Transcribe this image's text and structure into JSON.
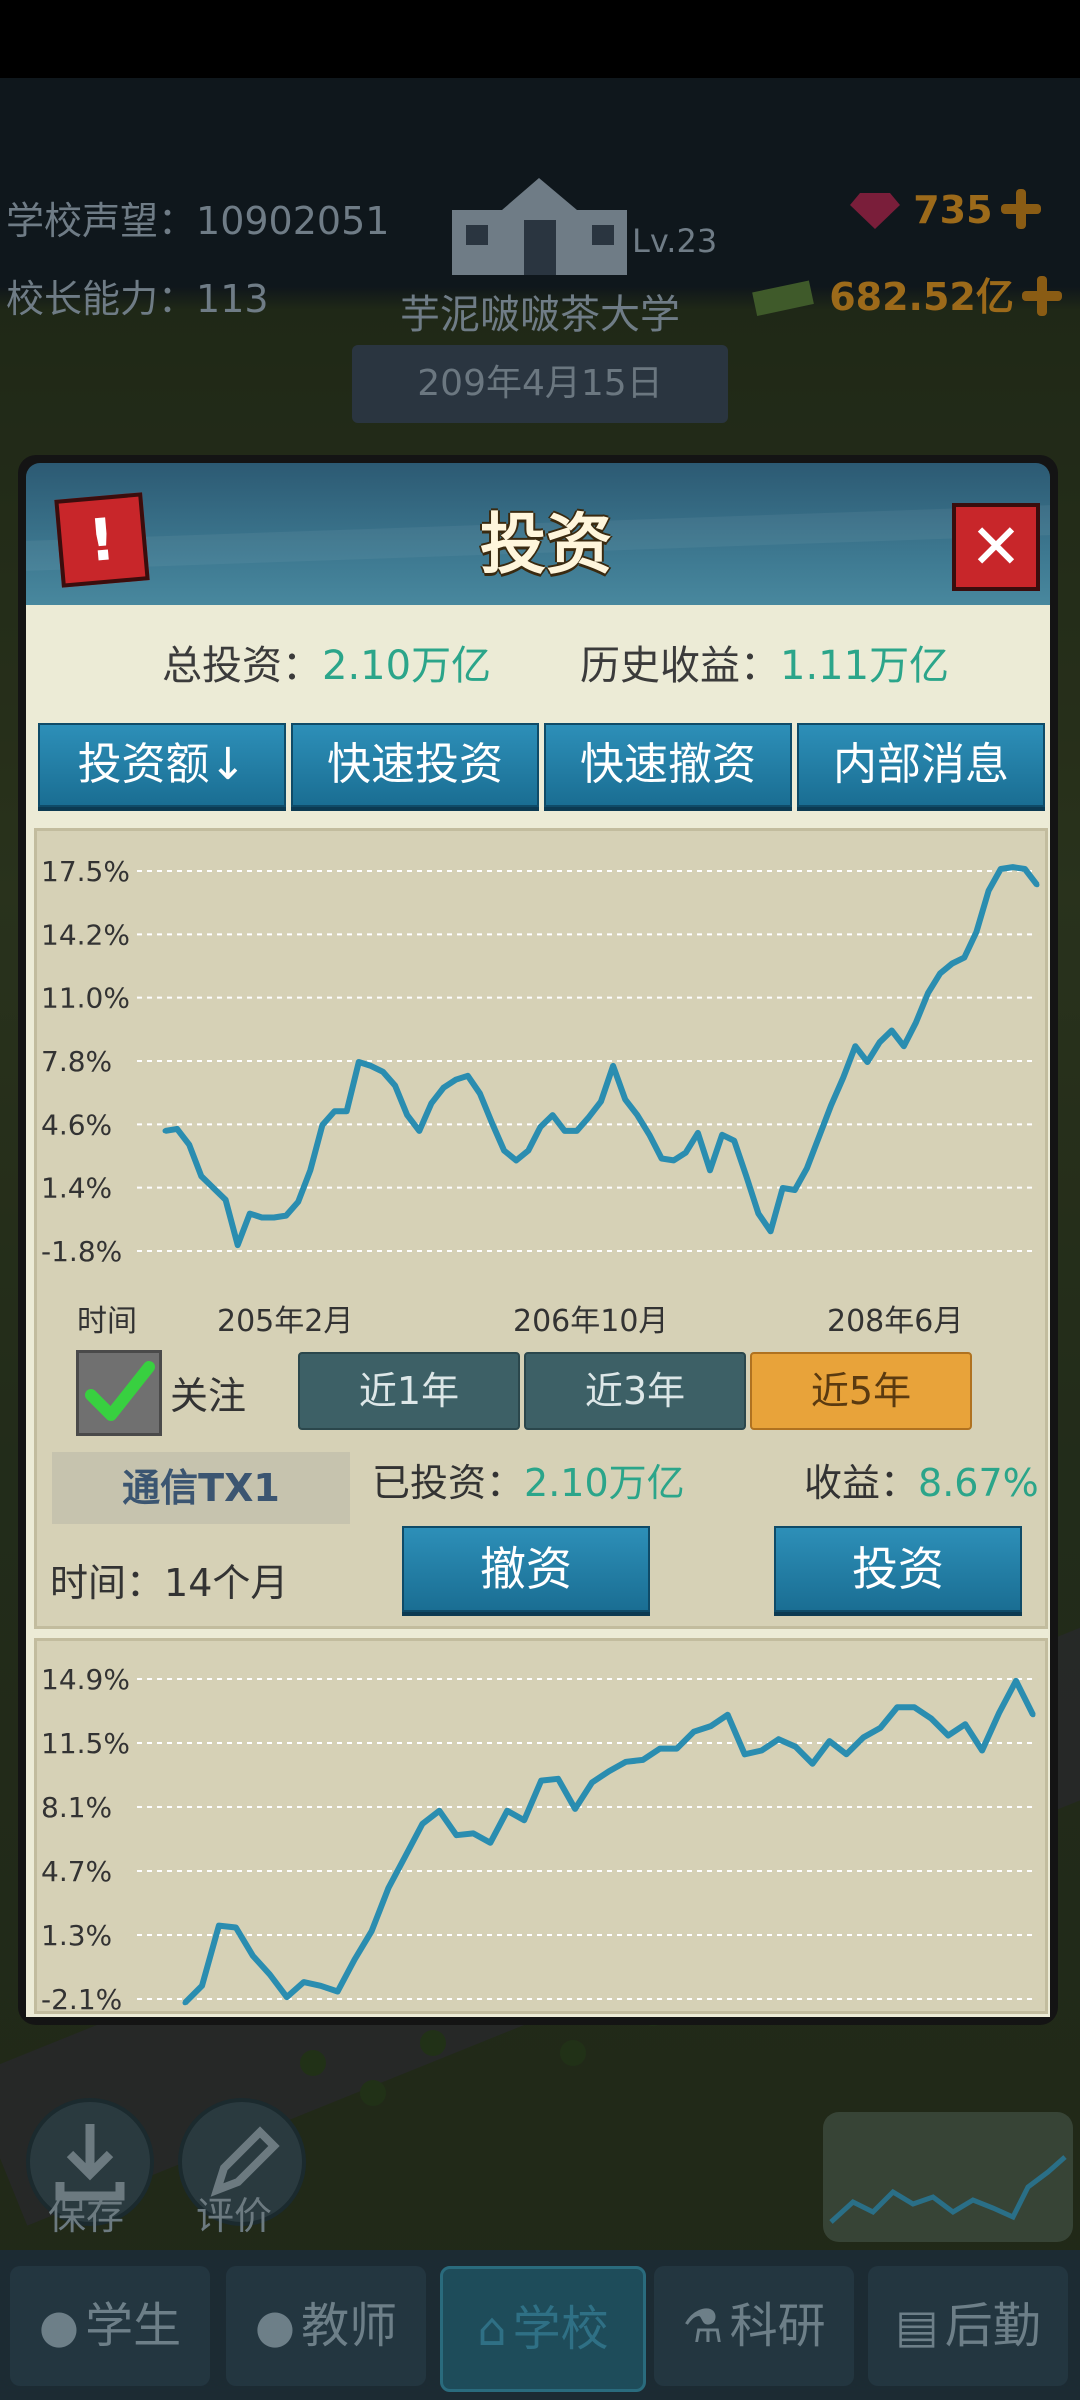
{
  "header": {
    "reputation_label": "学校声望：",
    "reputation_value": "10902051",
    "ability_label": "校长能力：",
    "ability_value": "113",
    "school_name": "芋泥啵啵茶大学",
    "level": "Lv.23",
    "date": "209年4月15日",
    "gems": "735",
    "money": "682.52亿"
  },
  "modal": {
    "title": "投资",
    "total_label": "总投资：",
    "total_value": "2.10万亿",
    "history_label": "历史收益：",
    "history_value": "1.11万亿",
    "tabs": [
      "投资额↓",
      "快速投资",
      "快速撤资",
      "内部消息"
    ],
    "follow_label": "关注",
    "follow_checked": true,
    "periods": [
      "近1年",
      "近3年",
      "近5年"
    ],
    "active_period": "近5年",
    "stock": {
      "name": "通信TX1",
      "invested_label": "已投资：",
      "invested_value": "2.10万亿",
      "return_label": "收益：",
      "return_value": "8.67%",
      "time_label": "时间：",
      "time_value": "14个月"
    },
    "actions": [
      "撤资",
      "投资"
    ]
  },
  "chart_data": [
    {
      "type": "line",
      "ytick_labels": [
        "17.5%",
        "14.2%",
        "11.0%",
        "7.8%",
        "4.6%",
        "1.4%",
        "-1.8%"
      ],
      "ylim": [
        -1.8,
        17.5
      ],
      "xlabel": "时间",
      "xtick_labels": [
        "205年2月",
        "206年10月",
        "208年6月"
      ],
      "grid": true,
      "color": "#2a8db0",
      "values": [
        4.3,
        4.4,
        3.6,
        2.0,
        1.4,
        0.8,
        -1.5,
        0.1,
        -0.1,
        -0.1,
        0.0,
        0.7,
        2.3,
        4.6,
        5.3,
        5.3,
        7.8,
        7.6,
        7.3,
        6.6,
        5.1,
        4.3,
        5.7,
        6.5,
        6.9,
        7.1,
        6.2,
        4.7,
        3.3,
        2.8,
        3.3,
        4.5,
        5.1,
        4.3,
        4.3,
        5.0,
        5.8,
        7.6,
        5.9,
        5.1,
        4.1,
        2.9,
        2.8,
        3.2,
        4.2,
        2.3,
        4.1,
        3.8,
        2.0,
        0.1,
        -0.8,
        1.4,
        1.3,
        2.4,
        4.0,
        5.6,
        7.0,
        8.6,
        7.8,
        8.8,
        9.4,
        8.6,
        9.8,
        11.3,
        12.3,
        12.8,
        13.1,
        14.4,
        16.5,
        17.6,
        17.7,
        17.6,
        16.8
      ]
    },
    {
      "type": "line",
      "ytick_labels": [
        "14.9%",
        "11.5%",
        "8.1%",
        "4.7%",
        "1.3%",
        "-2.1%"
      ],
      "ylim": [
        -2.1,
        14.9
      ],
      "grid": true,
      "color": "#2a8db0",
      "values": [
        -2.3,
        -1.4,
        1.8,
        1.7,
        0.2,
        -0.8,
        -2.0,
        -1.2,
        -1.4,
        -1.7,
        0.0,
        1.5,
        3.8,
        5.5,
        7.2,
        7.9,
        6.6,
        6.7,
        6.2,
        7.9,
        7.4,
        9.5,
        9.6,
        8.0,
        9.4,
        10.0,
        10.5,
        10.6,
        11.2,
        11.2,
        12.1,
        12.4,
        13.0,
        10.9,
        11.1,
        11.7,
        11.3,
        10.4,
        11.6,
        10.9,
        11.8,
        12.3,
        13.4,
        13.4,
        12.8,
        11.9,
        12.5,
        11.1,
        13.1,
        14.8,
        13.0
      ]
    }
  ],
  "bottom": {
    "save_label": "保存",
    "review_label": "评价",
    "nav": [
      "学生",
      "教师",
      "学校",
      "科研",
      "后勤"
    ],
    "active_nav": "学校"
  }
}
